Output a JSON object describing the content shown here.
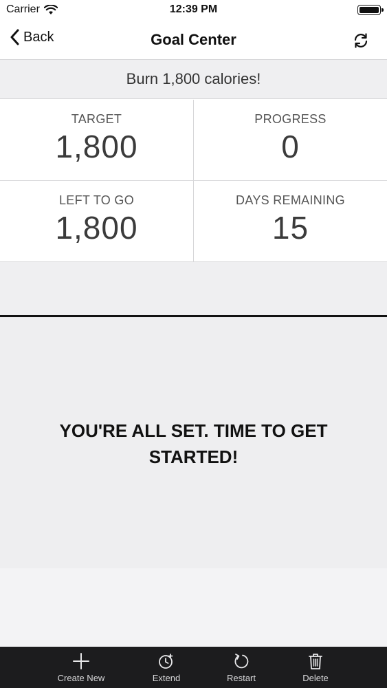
{
  "status_bar": {
    "carrier": "Carrier",
    "time": "12:39 PM"
  },
  "nav": {
    "back_label": "Back",
    "title": "Goal Center"
  },
  "goal": {
    "description": "Burn 1,800 calories!"
  },
  "stats": [
    {
      "label": "TARGET",
      "value": "1,800"
    },
    {
      "label": "PROGRESS",
      "value": "0"
    },
    {
      "label": "LEFT TO GO",
      "value": "1,800"
    },
    {
      "label": "DAYS REMAINING",
      "value": "15"
    }
  ],
  "empty_state": {
    "message": "YOU'RE ALL SET. TIME TO GET STARTED!"
  },
  "toolbar": {
    "items": [
      {
        "label": "Create New",
        "icon": "plus-icon"
      },
      {
        "label": "Extend",
        "icon": "clock-icon"
      },
      {
        "label": "Restart",
        "icon": "restart-icon"
      },
      {
        "label": "Delete",
        "icon": "trash-icon"
      }
    ]
  },
  "colors": {
    "toolbar_bg": "#1c1c1e",
    "banner_bg": "#efeff1",
    "panel_bg": "#eeeef0"
  }
}
